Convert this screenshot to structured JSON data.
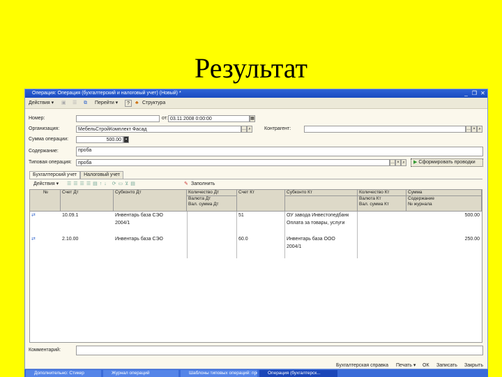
{
  "slide_title": "Результат",
  "window": {
    "title": "Операция: Операция (бухгалтерский и налоговый учет) (Новый) *"
  },
  "toolbar": {
    "actions": "Действия ▾",
    "goto": "Перейти ▾",
    "help": "?",
    "structure": "Структура"
  },
  "form": {
    "number_label": "Номер:",
    "number_value": "",
    "date_label": "от:",
    "date_value": "03.11.2008 0:00:00",
    "org_label": "Организация:",
    "org_value": "МебельСтройКомплект Фасад",
    "counterparty_label": "Контрагент:",
    "counterparty_value": "",
    "sum_label": "Сумма операции:",
    "sum_value": "500.00",
    "content_label": "Содержание:",
    "content_value": "проба",
    "typical_label": "Типовая операция:",
    "typical_value": "проба",
    "generate_button": "Сформировать проводки"
  },
  "tabs": [
    {
      "label": "Бухгалтерский учет"
    },
    {
      "label": "Налоговый учет"
    }
  ],
  "table_toolbar": {
    "actions": "Действия ▾",
    "fill": "Заполнить"
  },
  "table": {
    "headers": {
      "n": "№",
      "dt": "Счет Дт",
      "sub_dt": "Субконто Дт",
      "qty_dt": "Количество Дт",
      "cur_dt": "Валюта Дт",
      "cur_sum_dt": "Вал. сумма Дт",
      "kt": "Счет Кт",
      "sub_kt": "Субконто Кт",
      "qty_kt": "Количество Кт",
      "cur_kt": "Валюта Кт",
      "cur_sum_kt": "Вал. сумма Кт",
      "sum": "Сумма",
      "content": "Содержание",
      "journal": "№ журнала"
    },
    "rows": [
      {
        "dt": "10.09.1",
        "sub_dt": [
          "Инвентарь база СЭО",
          "2004/1"
        ],
        "kt": "51",
        "sub_kt": [
          "ОУ завода Инвестопедбанк",
          "Оплата за товары, услуги"
        ],
        "sum": "500.00"
      },
      {
        "dt": "2.10.00",
        "sub_dt": [
          "Инвентарь база СЭО"
        ],
        "kt": "60.0",
        "sub_kt": [
          "Инвентарь база ООО",
          "2004/1"
        ],
        "sum": "250.00"
      }
    ]
  },
  "comment_label": "Комментарий:",
  "bottom_buttons": [
    "Бухгалтерская справка",
    "Печать ▾",
    "ОК",
    "Записать",
    "Закрыть"
  ],
  "taskbar": [
    "Дополнительно: Стикер",
    "Журнал операций",
    "Шаблоны типовых операций: проба",
    "Операция (бухгалтерск..."
  ]
}
